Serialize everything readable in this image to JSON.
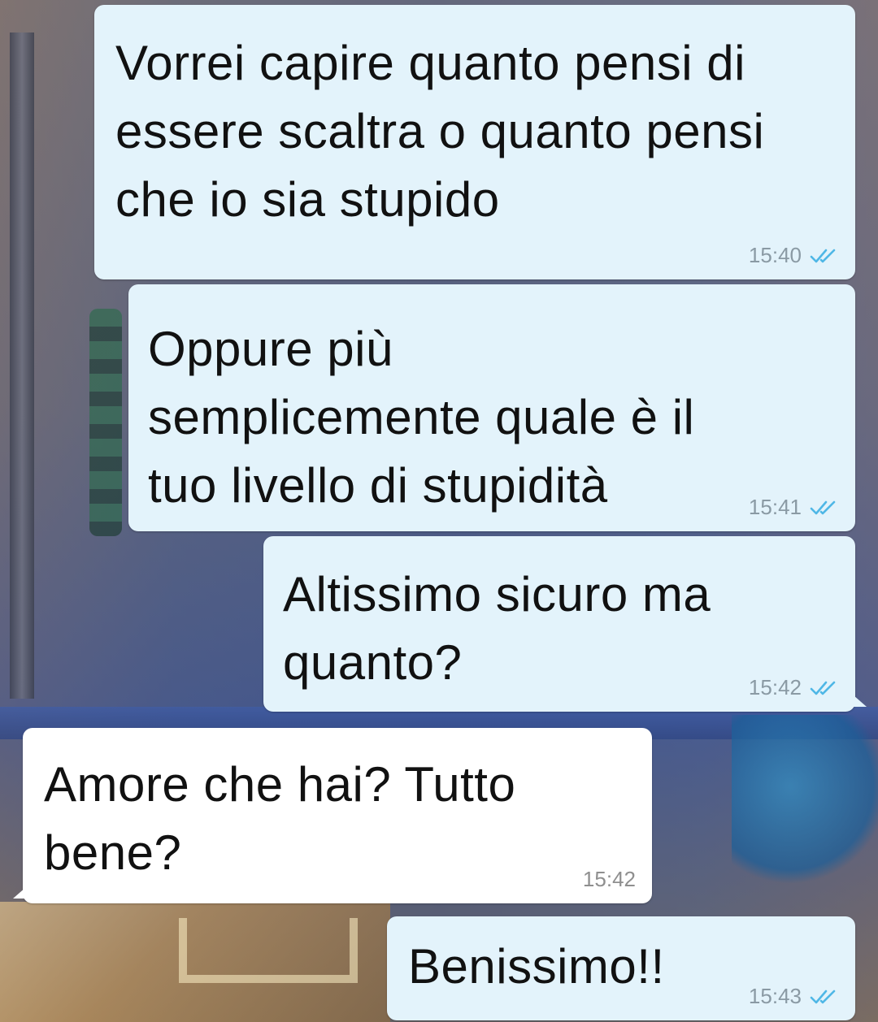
{
  "colors": {
    "outgoing_bubble": "#e3f3fb",
    "incoming_bubble": "#ffffff",
    "read_ticks": "#4fb7e6",
    "timestamp_out": "#8a9aa4",
    "timestamp_in": "#8f8f8f"
  },
  "messages": [
    {
      "direction": "outgoing",
      "text": "Vorrei capire quanto pensi di essere scaltra o quanto pensi che io sia stupido",
      "time": "15:40",
      "status_icon": "double-check-read-icon"
    },
    {
      "direction": "outgoing",
      "text": "Oppure più semplicemente quale è il tuo livello di stupidità",
      "time": "15:41",
      "status_icon": "double-check-read-icon"
    },
    {
      "direction": "outgoing",
      "text": "Altissimo sicuro ma quanto?",
      "time": "15:42",
      "status_icon": "double-check-read-icon"
    },
    {
      "direction": "incoming",
      "text": "Amore che hai? Tutto bene?",
      "time": "15:42"
    },
    {
      "direction": "outgoing",
      "text": "Benissimo!!",
      "time": "15:43",
      "status_icon": "double-check-read-icon"
    }
  ]
}
